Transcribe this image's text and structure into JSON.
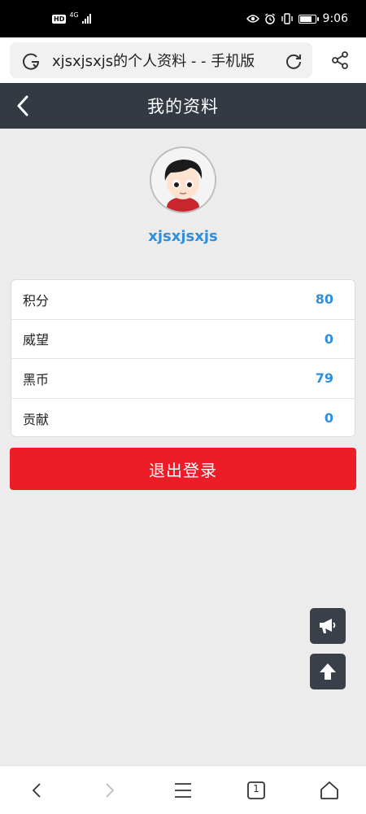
{
  "status_bar": {
    "hd_label": "HD",
    "network_label": "4G",
    "time": "9:06",
    "icons": [
      "eye-icon",
      "alarm-icon",
      "vibrate-icon",
      "battery-icon"
    ]
  },
  "browser": {
    "url_text": "xjsxjsxjs的个人资料 - - 手机版",
    "icons": [
      "g-search-icon",
      "reload-icon",
      "share-icon"
    ]
  },
  "header": {
    "title": "我的资料",
    "back_icon": "chevron-left-icon"
  },
  "profile": {
    "username": "xjsxjsxjs",
    "avatar_icon": "avatar-cartoon"
  },
  "stats": [
    {
      "label": "积分",
      "value": "80"
    },
    {
      "label": "威望",
      "value": "0"
    },
    {
      "label": "黑币",
      "value": "79"
    },
    {
      "label": "贡献",
      "value": "0"
    }
  ],
  "logout": {
    "label": "退出登录"
  },
  "float_buttons": {
    "announce_icon": "megaphone-icon",
    "top_icon": "arrow-up-icon"
  },
  "bottom_nav": {
    "tab_count": "1",
    "icons": [
      "back-icon",
      "forward-icon",
      "menu-icon",
      "tabs-icon",
      "home-icon"
    ]
  },
  "colors": {
    "accent": "#2f8fdc",
    "header_bg": "#343a44",
    "logout_bg": "#ee1c27",
    "page_bg": "#ececec"
  }
}
